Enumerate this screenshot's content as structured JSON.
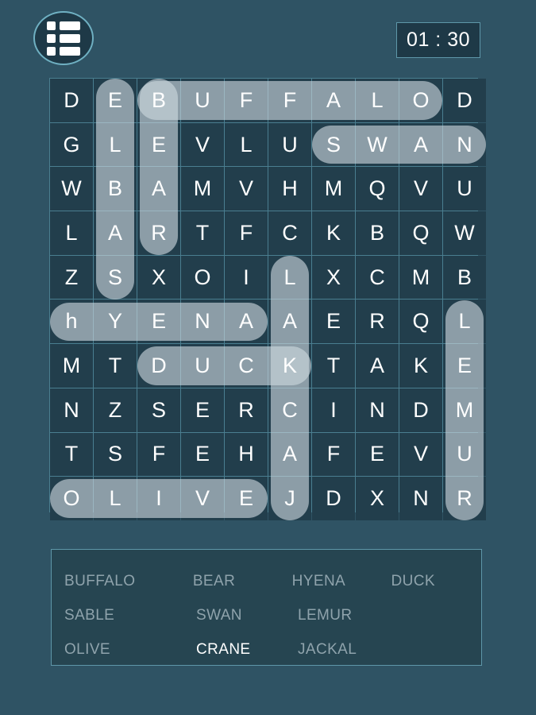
{
  "topbar": {
    "menu_icon": "list-menu-icon",
    "timer": "01 : 30"
  },
  "grid": {
    "rows": 10,
    "cols": 10,
    "letters": [
      [
        "D",
        "E",
        "B",
        "U",
        "F",
        "F",
        "A",
        "L",
        "O",
        "D"
      ],
      [
        "G",
        "L",
        "E",
        "V",
        "L",
        "U",
        "S",
        "W",
        "A",
        "N"
      ],
      [
        "W",
        "B",
        "A",
        "M",
        "V",
        "H",
        "M",
        "Q",
        "V",
        "U"
      ],
      [
        "L",
        "A",
        "R",
        "T",
        "F",
        "C",
        "K",
        "B",
        "Q",
        "W"
      ],
      [
        "Z",
        "S",
        "X",
        "O",
        "I",
        "L",
        "X",
        "C",
        "M",
        "B"
      ],
      [
        "h",
        "Y",
        "E",
        "N",
        "A",
        "A",
        "E",
        "R",
        "Q",
        "L"
      ],
      [
        "M",
        "T",
        "D",
        "U",
        "C",
        "K",
        "T",
        "A",
        "K",
        "E"
      ],
      [
        "N",
        "Z",
        "S",
        "E",
        "R",
        "C",
        "I",
        "N",
        "D",
        "M"
      ],
      [
        "T",
        "S",
        "F",
        "E",
        "H",
        "A",
        "F",
        "E",
        "V",
        "U"
      ],
      [
        "O",
        "L",
        "I",
        "V",
        "E",
        "J",
        "D",
        "X",
        "N",
        "R"
      ]
    ],
    "found_words": [
      {
        "word": "BUFFALO",
        "orientation": "horizontal",
        "row": 0,
        "col_start": 2,
        "col_end": 8,
        "state": "found"
      },
      {
        "word": "SWAN",
        "orientation": "horizontal",
        "row": 1,
        "col_start": 6,
        "col_end": 9,
        "state": "found"
      },
      {
        "word": "SABLE",
        "orientation": "vertical",
        "col": 1,
        "row_start": 0,
        "row_end": 4,
        "state": "found"
      },
      {
        "word": "BEAR",
        "orientation": "vertical",
        "col": 2,
        "row_start": 0,
        "row_end": 3,
        "state": "found"
      },
      {
        "word": "HYENA",
        "orientation": "horizontal",
        "row": 5,
        "col_start": 0,
        "col_end": 4,
        "state": "found"
      },
      {
        "word": "DUCK",
        "orientation": "horizontal",
        "row": 6,
        "col_start": 2,
        "col_end": 5,
        "state": "found"
      },
      {
        "word": "JACKAL",
        "orientation": "vertical",
        "col": 5,
        "row_start": 4,
        "row_end": 9,
        "state": "found"
      },
      {
        "word": "LEMUR",
        "orientation": "vertical",
        "col": 9,
        "row_start": 5,
        "row_end": 9,
        "state": "found"
      },
      {
        "word": "OLIVE",
        "orientation": "horizontal",
        "row": 9,
        "col_start": 0,
        "col_end": 4,
        "state": "found"
      }
    ]
  },
  "wordlist": {
    "rows": [
      [
        {
          "label": "BUFFALO",
          "state": "found"
        },
        {
          "label": "BEAR",
          "state": "found"
        },
        {
          "label": "HYENA",
          "state": "found"
        },
        {
          "label": "DUCK",
          "state": "found"
        }
      ],
      [
        {
          "label": "SABLE",
          "state": "found"
        },
        {
          "label": "SWAN",
          "state": "found"
        },
        {
          "label": "LEMUR",
          "state": "found"
        }
      ],
      [
        {
          "label": "OLIVE",
          "state": "found"
        },
        {
          "label": "CRANE",
          "state": "remaining"
        },
        {
          "label": "JACKAL",
          "state": "found"
        }
      ]
    ]
  },
  "colors": {
    "page_background": "#2f5364",
    "cell_background": "#223e4c",
    "grid_line": "#4a7e90",
    "accent_border": "#5e97a9",
    "letter": "#ffffff",
    "word_found": "#8fa3ac",
    "word_remaining": "#ffffff",
    "highlight": "#cdd8df"
  }
}
